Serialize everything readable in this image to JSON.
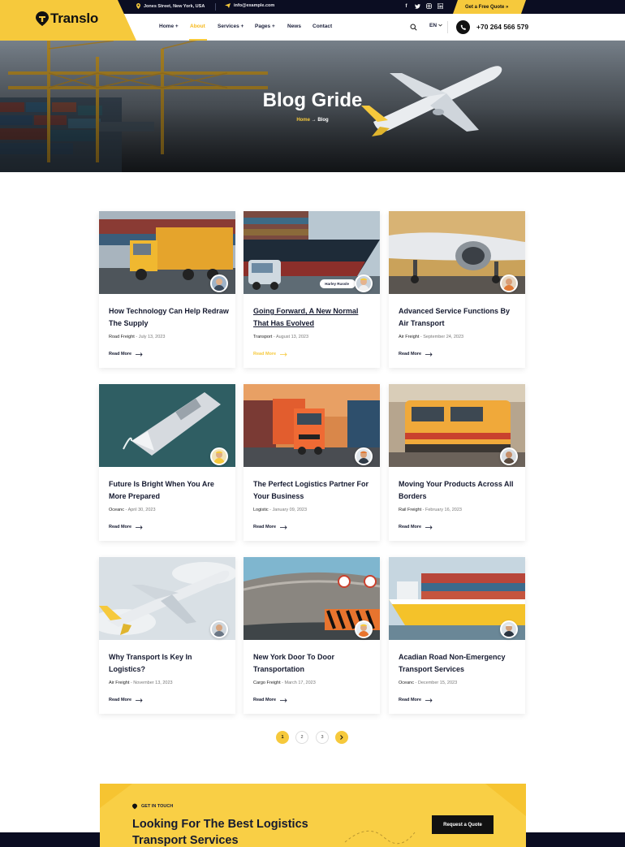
{
  "topbar": {
    "address": "Jones Street, New York, USA",
    "email": "info@example.com",
    "social": [
      "f",
      "t",
      "ig",
      "in"
    ],
    "quote_label": "Get a Free Quote »"
  },
  "brand": {
    "name": "Translo"
  },
  "nav": {
    "items": [
      {
        "label": "Home +"
      },
      {
        "label": "About"
      },
      {
        "label": "Services +"
      },
      {
        "label": "Pages +"
      },
      {
        "label": "News"
      },
      {
        "label": "Contact"
      }
    ],
    "active_index": 1,
    "language": "EN",
    "phone": "+70 264 566 579"
  },
  "hero": {
    "title": "Blog Gride",
    "breadcrumb_home": "Home",
    "breadcrumb_arrow": "→",
    "breadcrumb_current": "Blog"
  },
  "posts": [
    {
      "title": "How Technology Can Help Redraw The Supply",
      "category": "Road Freight",
      "date": "July 13, 2023",
      "more": "Read More"
    },
    {
      "title": "Going Forward, A New Normal That Has Evolved",
      "category": "Transport",
      "date": "August 13, 2023",
      "more": "Read More",
      "author": "Harley Russle"
    },
    {
      "title": "Advanced Service Functions By Air Transport",
      "category": "Air Freight",
      "date": "September 24, 2023",
      "more": "Read More"
    },
    {
      "title": "Future Is Bright When You Are More Prepared",
      "category": "Oceanc",
      "date": "April 30, 2023",
      "more": "Read More"
    },
    {
      "title": "The Perfect Logistics Partner For Your Business",
      "category": "Logistic",
      "date": "January 09, 2023",
      "more": "Read More"
    },
    {
      "title": "Moving Your Products Across All Borders",
      "category": "Rail Freight",
      "date": "February 16, 2023",
      "more": "Read More"
    },
    {
      "title": "Why Transport Is Key In Logistics?",
      "category": "Air Freight",
      "date": "November 13, 2023",
      "more": "Read More"
    },
    {
      "title": "New York Door To Door Transportation",
      "category": "Cargo Freight",
      "date": "March 17, 2023",
      "more": "Read More"
    },
    {
      "title": "Acadian Road Non-Emergency Transport Services",
      "category": "Oceanc",
      "date": "December 15, 2023",
      "more": "Read More"
    }
  ],
  "pagination": {
    "pages": [
      "1",
      "2",
      "3"
    ],
    "current": "1"
  },
  "cta": {
    "eyebrow": "GET IN TOUCH",
    "title": "Looking For The Best Logistics Transport Services",
    "button": "Request a Quote"
  },
  "colors": {
    "accent": "#f6c93c",
    "dark": "#0b0d22",
    "heading": "#151a30"
  }
}
